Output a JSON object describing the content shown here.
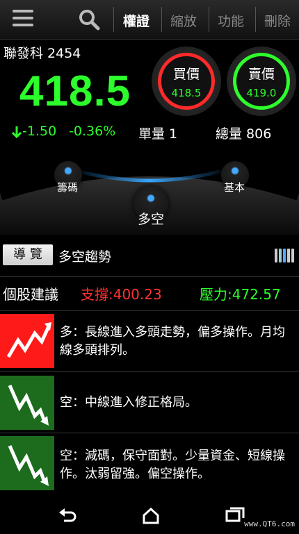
{
  "topbar": {
    "tabs": [
      {
        "label": "權證",
        "active": true
      },
      {
        "label": "縮放",
        "active": false
      },
      {
        "label": "功能",
        "active": false
      },
      {
        "label": "刪除",
        "active": false
      }
    ]
  },
  "quote": {
    "stock_name": "聯發科 2454",
    "price": "418.5",
    "change": "-1.50",
    "change_pct": "-0.36%",
    "unit_volume": "單量 1",
    "total_volume": "總量 806",
    "buy": {
      "label": "買價",
      "value": "418.5"
    },
    "sell": {
      "label": "賣價",
      "value": "419.0"
    }
  },
  "nodes": {
    "chips": "籌碼",
    "basic": "基本",
    "bull_bear": "多空"
  },
  "guide": {
    "button": "導 覽",
    "title": "多空趨勢"
  },
  "advice": {
    "title": "個股建議",
    "support": "支撐:400.23",
    "pressure": "壓力:472.57"
  },
  "rows": [
    {
      "text": "多：長線進入多頭走勢，偏多操作。月均線多頭排列。",
      "trend": "up"
    },
    {
      "text": "空：中線進入修正格局。",
      "trend": "down"
    },
    {
      "text": "空：減碼，保守面對。少量資金、短線操作。汰弱留強。偏空操作。",
      "trend": "down"
    }
  ],
  "watermark": "www.QT6.com",
  "colors": {
    "up": "#2cff2c",
    "down_red": "#ff3333",
    "accent": "#3aa8ff"
  }
}
